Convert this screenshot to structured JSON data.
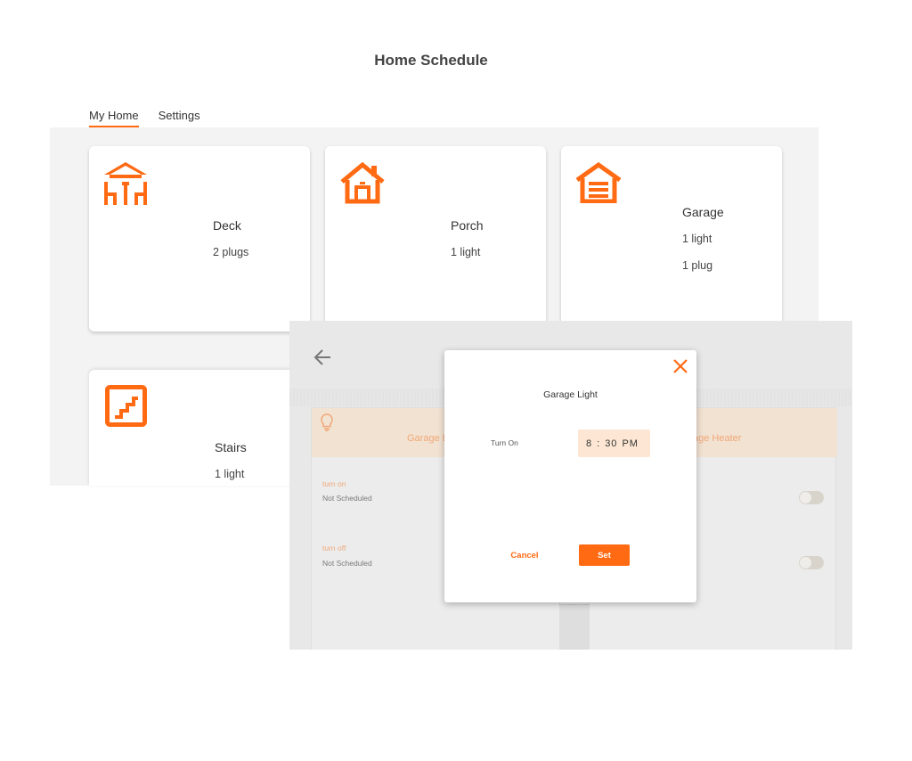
{
  "page": {
    "title": "Home Schedule"
  },
  "tabs": [
    {
      "label": "My Home",
      "active": true
    },
    {
      "label": "Settings",
      "active": false
    }
  ],
  "cards": {
    "deck": {
      "name": "Deck",
      "line1": "2 plugs",
      "icon": "deck-icon"
    },
    "porch": {
      "name": "Porch",
      "line1": "1 light",
      "icon": "house-icon"
    },
    "garage": {
      "name": "Garage",
      "line1": "1 light",
      "line2": "1 plug",
      "icon": "garage-icon"
    },
    "stairs": {
      "name": "Stairs",
      "line1": "1 light",
      "icon": "stairs-icon"
    }
  },
  "overlay": {
    "left_panel": {
      "header": "Garage L",
      "turn_on_label": "turn on",
      "turn_on_value": "Not Scheduled",
      "turn_off_label": "turn off",
      "turn_off_value": "Not Scheduled"
    },
    "right_panel": {
      "header": "age Heater"
    }
  },
  "dialog": {
    "title": "Garage Light",
    "turn_on_label": "Turn On",
    "time": {
      "hour": "8",
      "sep": ":",
      "minute": "30",
      "period": "PM"
    },
    "cancel_label": "Cancel",
    "set_label": "Set"
  },
  "colors": {
    "accent": "#ff6a13",
    "header_tint": "#f2e2d2",
    "time_field": "#fde7d4"
  }
}
